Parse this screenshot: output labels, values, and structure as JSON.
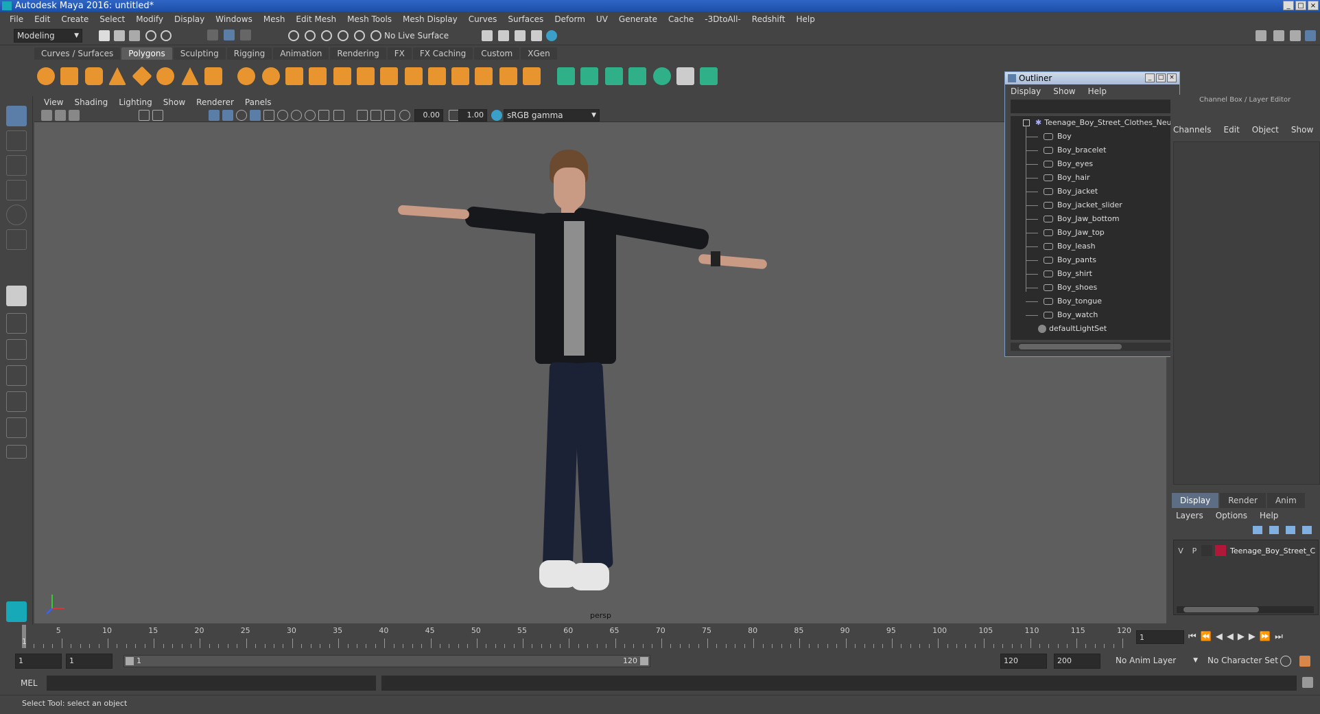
{
  "window": {
    "title": "Autodesk Maya 2016: untitled*"
  },
  "menubar": {
    "items": [
      "File",
      "Edit",
      "Create",
      "Select",
      "Modify",
      "Display",
      "Windows",
      "Mesh",
      "Edit Mesh",
      "Mesh Tools",
      "Mesh Display",
      "Curves",
      "Surfaces",
      "Deform",
      "UV",
      "Generate",
      "Cache",
      "-3DtoAll-",
      "Redshift",
      "Help"
    ]
  },
  "statusline": {
    "mode": "Modeling",
    "live_surface": "No Live Surface"
  },
  "shelf": {
    "tabs": [
      "Curves / Surfaces",
      "Polygons",
      "Sculpting",
      "Rigging",
      "Animation",
      "Rendering",
      "FX",
      "FX Caching",
      "Custom",
      "XGen"
    ],
    "active_tab": "Polygons"
  },
  "viewport": {
    "menu": [
      "View",
      "Shading",
      "Lighting",
      "Show",
      "Renderer",
      "Panels"
    ],
    "exposure": "0.00",
    "gamma": "1.00",
    "color_space": "sRGB gamma",
    "camera_label": "persp"
  },
  "outliner": {
    "title": "Outliner",
    "menu": [
      "Display",
      "Show",
      "Help"
    ],
    "root": "Teenage_Boy_Street_Clothes_Neu",
    "children": [
      "Boy",
      "Boy_bracelet",
      "Boy_eyes",
      "Boy_hair",
      "Boy_jacket",
      "Boy_jacket_slider",
      "Boy_Jaw_bottom",
      "Boy_Jaw_top",
      "Boy_leash",
      "Boy_pants",
      "Boy_shirt",
      "Boy_shoes",
      "Boy_tongue",
      "Boy_watch"
    ],
    "light_set": "defaultLightSet"
  },
  "channelbox": {
    "title": "Channel Box / Layer Editor",
    "menu": [
      "Channels",
      "Edit",
      "Object",
      "Show"
    ]
  },
  "layer_editor": {
    "tabs": [
      "Display",
      "Render",
      "Anim"
    ],
    "active_tab": "Display",
    "menu": [
      "Layers",
      "Options",
      "Help"
    ],
    "layer": {
      "v": "V",
      "p": "P",
      "name": "Teenage_Boy_Street_C",
      "color": "#b0183a"
    }
  },
  "timeslider": {
    "ticks": [
      "5",
      "10",
      "15",
      "20",
      "25",
      "30",
      "35",
      "40",
      "45",
      "50",
      "55",
      "60",
      "65",
      "70",
      "75",
      "80",
      "85",
      "90",
      "95",
      "100",
      "105",
      "110",
      "115",
      "120"
    ],
    "start_marker": "1",
    "current_frame": "1"
  },
  "range": {
    "start": "1",
    "playback_start": "1",
    "range_start_label": "1",
    "range_end_label": "120",
    "playback_end": "120",
    "end": "200",
    "anim_layer": "No Anim Layer",
    "character_set": "No Character Set"
  },
  "cmdline": {
    "label": "MEL"
  },
  "helpline": {
    "text": "Select Tool: select an object"
  },
  "colors": {
    "accent": "#5a7ea8",
    "shelf_orange": "#e8952f",
    "shelf_green": "#2fb088"
  }
}
